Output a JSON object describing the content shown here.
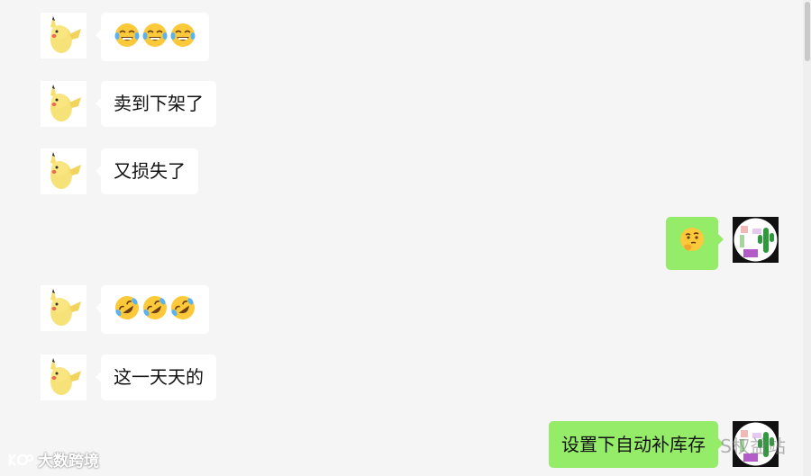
{
  "messages": [
    {
      "side": "left",
      "kind": "emoji",
      "emojis": [
        "laughing-tears",
        "laughing-tears",
        "laughing-tears"
      ]
    },
    {
      "side": "left",
      "kind": "text",
      "text": "卖到下架了"
    },
    {
      "side": "left",
      "kind": "text",
      "text": "又损失了"
    },
    {
      "side": "right",
      "kind": "emoji",
      "emojis": [
        "thinking"
      ]
    },
    {
      "side": "left",
      "kind": "emoji",
      "emojis": [
        "rolling-laughing",
        "rolling-laughing",
        "rolling-laughing"
      ]
    },
    {
      "side": "left",
      "kind": "text",
      "text": "这一天天的"
    },
    {
      "side": "right",
      "kind": "text",
      "text": "设置下自动补库存"
    }
  ],
  "watermarks": {
    "left": "大数跨境",
    "right": "S权益站"
  },
  "colors": {
    "background": "#f5f5f5",
    "incoming_bubble": "#ffffff",
    "outgoing_bubble": "#95ec69"
  },
  "icons": {
    "incoming_avatar": "pikachu-avatar",
    "outgoing_avatar": "cactus-avatar"
  }
}
